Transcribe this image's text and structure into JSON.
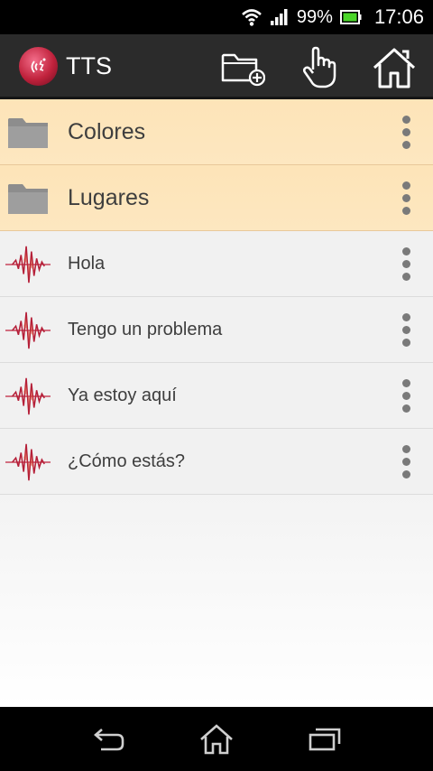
{
  "status_bar": {
    "battery_percent": "99%",
    "time": "17:06",
    "icons": [
      "wifi-icon",
      "signal-icon",
      "battery-icon"
    ]
  },
  "action_bar": {
    "title": "TTS",
    "logo_icon": "app-logo-icon",
    "actions": [
      "add-folder-icon",
      "hand-pointer-icon",
      "home-icon"
    ]
  },
  "list": {
    "folders": [
      {
        "label": "Colores",
        "icon": "folder-icon"
      },
      {
        "label": "Lugares",
        "icon": "folder-icon"
      }
    ],
    "phrases": [
      {
        "label": "Hola",
        "icon": "waveform-icon"
      },
      {
        "label": "Tengo un problema",
        "icon": "waveform-icon"
      },
      {
        "label": "Ya estoy aquí",
        "icon": "waveform-icon"
      },
      {
        "label": "¿Cómo estás?",
        "icon": "waveform-icon"
      }
    ]
  },
  "nav_bar": {
    "buttons": [
      "back-icon",
      "home-icon",
      "recent-apps-icon"
    ]
  },
  "colors": {
    "folder_row": "#fde4b8",
    "phrase_row": "#f1f1f1",
    "action_bar": "#2b2b2b",
    "accent": "#c0223c"
  }
}
